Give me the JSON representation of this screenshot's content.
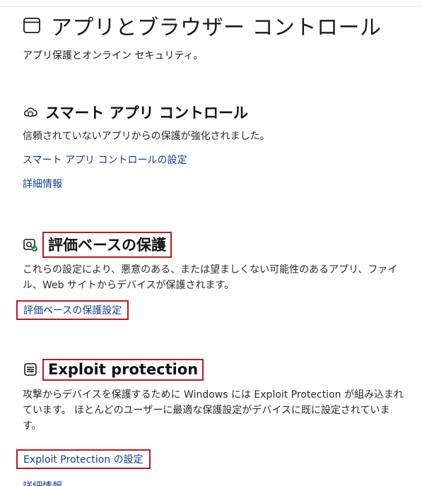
{
  "page": {
    "title": "アプリとブラウザー コントロール",
    "subtitle": "アプリ保護とオンライン セキュリティ。"
  },
  "smart_app_control": {
    "title": "スマート アプリ コントロール",
    "description": "信頼されていないアプリからの保護が強化されました。",
    "settings_link": "スマート アプリ コントロールの設定",
    "learn_more_link": "詳細情報",
    "icon": "shield-cloud-icon"
  },
  "reputation_protection": {
    "title": "評価ベースの保護",
    "description": "これらの設定により、悪意のある、または望ましくない可能性のあるアプリ、ファイル、Web サイトからデバイスが保護されます。",
    "settings_link": "評価ベースの保護設定",
    "icon": "reputation-check-icon"
  },
  "exploit_protection": {
    "title": "Exploit protection",
    "description": "攻撃からデバイスを保護するために Windows には Exploit Protection が組み込まれています。 ほとんどのユーザーに最適な保護設定がデバイスに既に設定されています。",
    "settings_link": "Exploit Protection の設定",
    "learn_more_link": "詳細情報",
    "icon": "exploit-shield-icon"
  },
  "colors": {
    "link": "#0f3e8f",
    "highlight_box": "#c0171c"
  }
}
